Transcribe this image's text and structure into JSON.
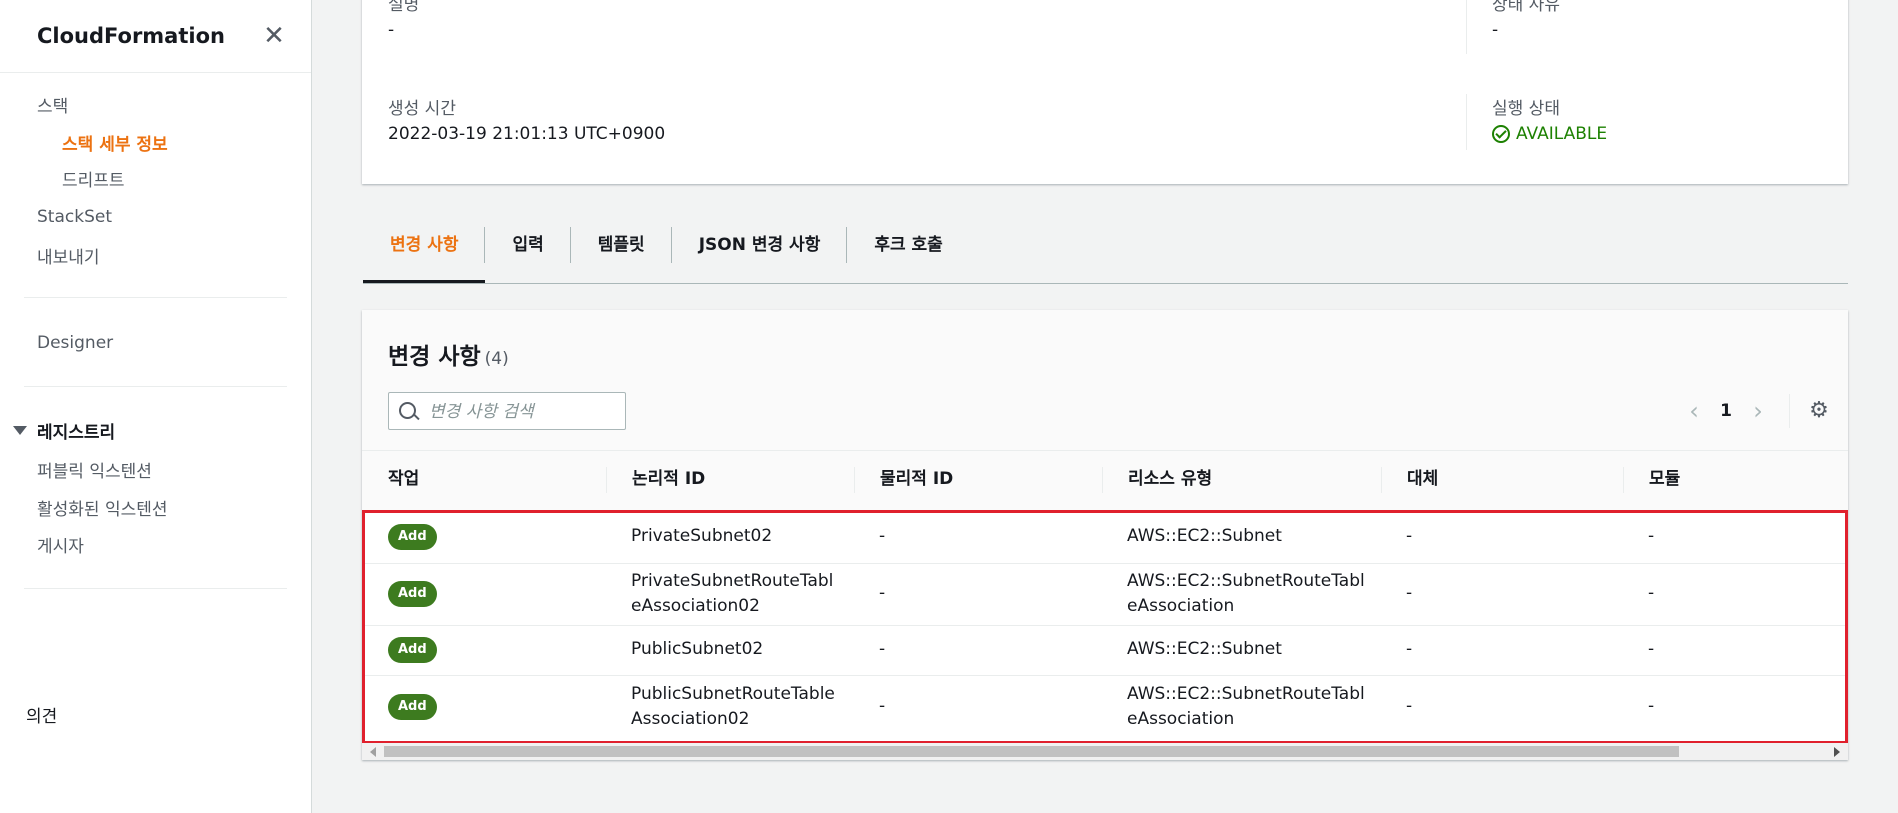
{
  "sidebar": {
    "title": "CloudFormation",
    "items": {
      "stacks": "스택",
      "stack_details": "스택 세부 정보",
      "drift": "드리프트",
      "stackset": "StackSet",
      "exports": "내보내기",
      "designer": "Designer"
    },
    "registry": {
      "section": "레지스트리",
      "public_extensions": "퍼블릭 익스텐션",
      "activated_extensions": "활성화된 익스텐션",
      "publisher": "게시자"
    },
    "feedback": "의견"
  },
  "details": {
    "description_label": "설명",
    "description_value": "-",
    "status_reason_label": "상태 사유",
    "status_reason_value": "-",
    "created_label": "생성 시간",
    "created_value": "2022-03-19 21:01:13 UTC+0900",
    "execution_status_label": "실행 상태",
    "execution_status_value": "AVAILABLE",
    "status_color": "#1d8102"
  },
  "tabs": [
    "변경 사항",
    "입력",
    "템플릿",
    "JSON 변경 사항",
    "후크 호출"
  ],
  "changes": {
    "title": "변경 사항",
    "count": "(4)",
    "search_placeholder": "변경 사항 검색",
    "page": "1",
    "columns": [
      "작업",
      "논리적 ID",
      "물리적 ID",
      "리소스 유형",
      "대체",
      "모듈"
    ],
    "rows": [
      {
        "action": "Add",
        "logical_id_1": "PrivateSubnet02",
        "logical_id_2": "",
        "physical_id": "-",
        "type_1": "AWS::EC2::Subnet",
        "type_2": "",
        "replacement": "-",
        "module": "-"
      },
      {
        "action": "Add",
        "logical_id_1": "PrivateSubnetRouteTabl",
        "logical_id_2": "eAssociation02",
        "physical_id": "-",
        "type_1": "AWS::EC2::SubnetRouteTabl",
        "type_2": "eAssociation",
        "replacement": "-",
        "module": "-"
      },
      {
        "action": "Add",
        "logical_id_1": "PublicSubnet02",
        "logical_id_2": "",
        "physical_id": "-",
        "type_1": "AWS::EC2::Subnet",
        "type_2": "",
        "replacement": "-",
        "module": "-"
      },
      {
        "action": "Add",
        "logical_id_1": "PublicSubnetRouteTable",
        "logical_id_2": "Association02",
        "physical_id": "-",
        "type_1": "AWS::EC2::SubnetRouteTabl",
        "type_2": "eAssociation",
        "replacement": "-",
        "module": "-"
      }
    ]
  },
  "colors": {
    "accent": "#ec7211",
    "badge": "#3d7b1f",
    "highlight": "#e0202d"
  }
}
